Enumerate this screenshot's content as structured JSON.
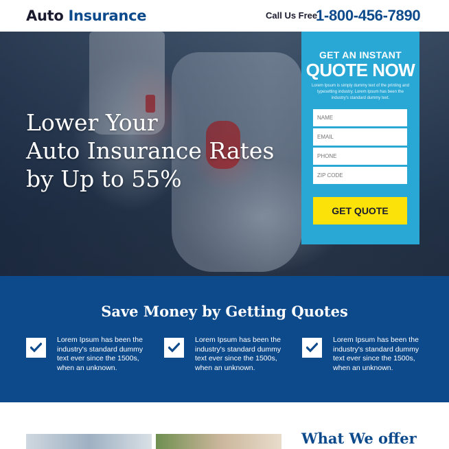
{
  "header": {
    "logo_part1": "Auto",
    "logo_part2": "Insurance",
    "call_label": "Call Us Free",
    "phone": "1-800-456-7890"
  },
  "hero": {
    "headline_line1": "Lower Your",
    "headline_line2": "Auto Insurance Rates",
    "headline_line3": "by Up to 55%"
  },
  "form": {
    "title_small": "GET AN INSTANT",
    "title_large": "QUOTE NOW",
    "description": "Lorem Ipsum is simply dummy text of the printing and typesetting industry. Lorem Ipsum has been the industry's standard dummy text.",
    "name_placeholder": "NAME",
    "email_placeholder": "EMAIL",
    "phone_placeholder": "PHONE",
    "zip_placeholder": "ZIP CODE",
    "button_label": "GET QUOTE"
  },
  "benefits": {
    "title": "Save Money by Getting Quotes",
    "items": [
      {
        "text": "Lorem Ipsum has been the industry's standard dummy text ever since the 1500s, when an unknown."
      },
      {
        "text": "Lorem Ipsum has been the industry's standard dummy text ever since the 1500s, when an unknown."
      },
      {
        "text": "Lorem Ipsum has been the industry's standard dummy text ever since the 1500s, when an unknown."
      }
    ]
  },
  "offer": {
    "title": "What We offer"
  },
  "colors": {
    "brand_blue": "#0d4a8c",
    "form_blue": "#29a8d6",
    "button_yellow": "#fbe30a"
  }
}
